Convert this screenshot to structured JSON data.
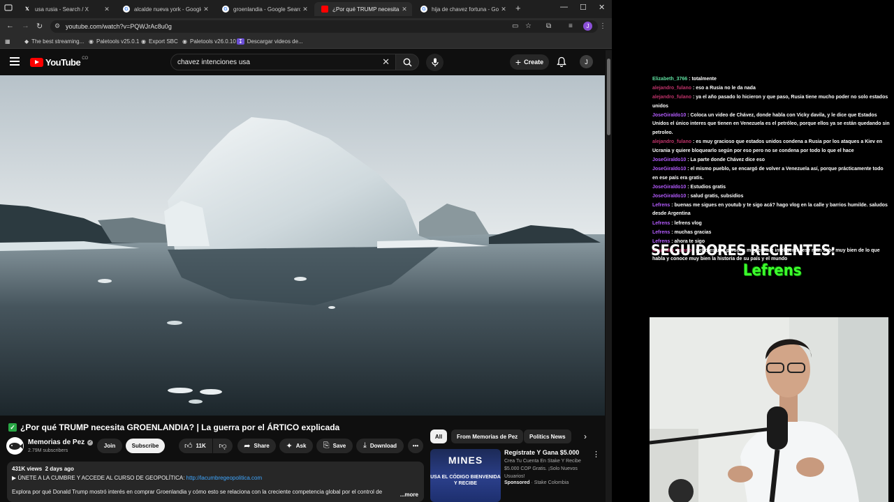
{
  "browser": {
    "tabs": [
      {
        "title": "usa rusia - Search / X",
        "favicon": "x-icon",
        "active": false
      },
      {
        "title": "alcalde nueva york - Google Se",
        "favicon": "google-icon",
        "active": false
      },
      {
        "title": "groenlandia - Google Search",
        "favicon": "google-icon",
        "active": false
      },
      {
        "title": "¿Por qué TRUMP necesita G",
        "favicon": "youtube-icon",
        "active": true
      },
      {
        "title": "hija de chavez fortuna - Google",
        "favicon": "google-icon",
        "active": false
      }
    ],
    "url": "youtube.com/watch?v=PQWJrAc8u0g",
    "profile_initial": "J",
    "bookmarks": [
      {
        "label": "The best streaming..."
      },
      {
        "label": "Paletools v25.0.1"
      },
      {
        "label": "Export SBC"
      },
      {
        "label": "Paletools v26.0.10"
      },
      {
        "label": "Descargar videos de..."
      }
    ]
  },
  "youtube": {
    "logo_text": "YouTube",
    "logo_country": "CO",
    "search_query": "chavez intenciones usa",
    "create_label": "Create",
    "avatar_initial": "J",
    "video": {
      "title": "¿Por qué TRUMP necesita GROENLANDIA? | La guerra por el ÁRTICO explicada",
      "channel": "Memorias de Pez",
      "subscribers": "2.79M subscribers",
      "join_label": "Join",
      "subscribe_label": "Subscribe",
      "likes": "11K",
      "share_label": "Share",
      "ask_label": "Ask",
      "save_label": "Save",
      "download_label": "Download",
      "views": "431K views",
      "date": "2 days ago",
      "desc_line1_prefix": "▶ ÚNETE A LA CUMBRE Y ACCEDE AL CURSO DE GEOPOLÍTICA: ",
      "desc_link": "http://lacumbregeopolitica.com",
      "desc_line2": "Explora por qué Donald Trump mostró interés en comprar Groenlandia y cómo esto se relaciona con la creciente competencia global por el control de",
      "more_label": "...more"
    },
    "chips": [
      {
        "label": "All",
        "active": true
      },
      {
        "label": "From Memorias de Pez",
        "active": false
      },
      {
        "label": "Politics News",
        "active": false
      }
    ],
    "ad": {
      "thumb_title": "MINES",
      "thumb_sub": "USA EL CÓDIGO BIENVENIDA Y RECIBE",
      "title": "Regístrate Y Gana $5.000",
      "description": "Crea Tu Cuenta En Stake Y Recibe $5.000 COP Gratis. ¡Solo Nuevos Usuarios!",
      "sponsored_label": "Sponsored",
      "advertiser": "Stake Colombia"
    }
  },
  "stream": {
    "chat": [
      {
        "user": "Elizabeth_3766",
        "color": "#5fe0a0",
        "text": "totalmente"
      },
      {
        "user": "alejandro_fulano",
        "color": "#c0336a",
        "text": "eso a Rusia no le da nada"
      },
      {
        "user": "alejandro_fulano",
        "color": "#c0336a",
        "text": "ya el año pasado lo hicieron y que paso, Rusia tiene mucho poder no solo estados unidos"
      },
      {
        "user": "JoseGiraldo10",
        "color": "#b55cff",
        "text": "Coloca un video de Chávez, donde habla con Vicky davila, y le dice que Estados Unidos el único interes que tienen en Venezuela es el petróleo, porque ellos ya se están quedando sin petroleo."
      },
      {
        "user": "alejandro_fulano",
        "color": "#c0336a",
        "text": "es muy gracioso que estados unidos condena a Rusia por los ataques a Kiev en Ucrania y quiere bloquearlo según por eso pero no se condena por todo lo que el hace"
      },
      {
        "user": "JoseGiraldo10",
        "color": "#b55cff",
        "text": "La parte donde Chávez dice eso"
      },
      {
        "user": "JoseGiraldo10",
        "color": "#b55cff",
        "text": "el mismo pueblo, se encargó de volver a Venezuela así, porque prácticamente todo en ese país era gratis."
      },
      {
        "user": "JoseGiraldo10",
        "color": "#b55cff",
        "text": "Estudios gratis"
      },
      {
        "user": "JoseGiraldo10",
        "color": "#b55cff",
        "text": "salud gratis, subsidios"
      },
      {
        "user": "Lefrens",
        "color": "#b55cff",
        "text": "buenas me sigues en youtub y te sigo acá? hago vlog en la calle y barrios humilde. saludos desde Argentina"
      },
      {
        "user": "Lefrens",
        "color": "#b55cff",
        "text": "lefrens vlog"
      },
      {
        "user": "Lefrens",
        "color": "#b55cff",
        "text": "muchas gracias"
      },
      {
        "user": "Lefrens",
        "color": "#b55cff",
        "text": "ahora te sigo"
      },
      {
        "user": "alejandro_fulano",
        "color": "#c0336a",
        "text": "petro es una persona muy culta e inteligente, ese man sabe muy bien de lo que habla y conoce muy bien la historia de su país y el mundo"
      }
    ],
    "followers_title": "SEGUIDORES RECIENTES:",
    "latest_follower": "Lefrens"
  }
}
